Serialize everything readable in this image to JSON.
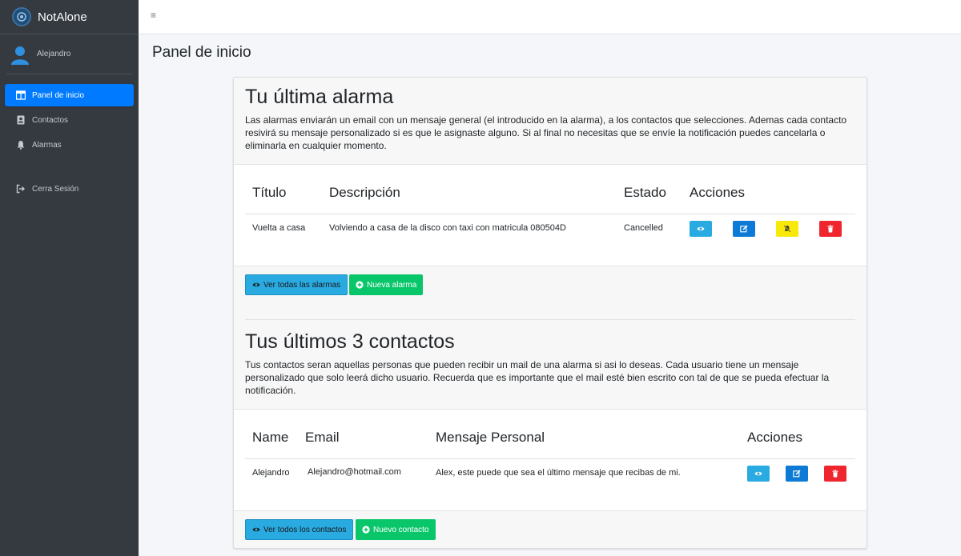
{
  "app": {
    "name": "NotAlone"
  },
  "user": {
    "name": "Alejandro"
  },
  "sidebar": {
    "items": [
      {
        "label": "Panel de inicio",
        "active": true
      },
      {
        "label": "Contactos",
        "active": false
      },
      {
        "label": "Alarmas",
        "active": false
      },
      {
        "label": "Cerra Sesión",
        "active": false
      }
    ]
  },
  "topbar": {
    "menu_glyph": "≡"
  },
  "page": {
    "title": "Panel de inicio"
  },
  "alarms": {
    "title": "Tu última alarma",
    "description": "Las alarmas enviarán un email con un mensaje general (el introducido en la alarma), a los contactos que selecciones. Ademas cada contacto resivirá su mensaje personalizado si es que le asignaste alguno. Si al final no necesitas que se envíe la notificación puedes cancelarla o eliminarla en cualquier momento.",
    "columns": [
      "Título",
      "Descripción",
      "Estado",
      "Acciones"
    ],
    "rows": [
      {
        "titulo": "Vuelta a casa",
        "descripcion": "Volviendo a casa de la disco con taxi con matricula 080504D",
        "estado": "Cancelled"
      }
    ],
    "view_all_label": "Ver todas las alarmas",
    "new_label": "Nueva alarma"
  },
  "contacts": {
    "title": "Tus últimos 3 contactos",
    "description": "Tus contactos seran aquellas personas que pueden recibir un mail de una alarma si asi lo deseas. Cada usuario tiene un mensaje personalizado que solo leerá dicho usuario. Recuerda que es importante que el mail esté bien escrito con tal de que se pueda efectuar la notificación.",
    "columns": [
      "Name",
      "Email",
      "Mensaje Personal",
      "Acciones"
    ],
    "rows": [
      {
        "name": "Alejandro",
        "email": "Alejandro@hotmail.com",
        "mensaje": "Alex, este puede que sea el último mensaje que recibas de mi."
      }
    ],
    "view_all_label": "Ver todos los contactos",
    "new_label": "Nuevo contacto"
  },
  "colors": {
    "sidebar": "#343a40",
    "active": "#007bff",
    "info": "#29aae1",
    "primary": "#0d7ad6",
    "warning": "#f9e90b",
    "danger": "#f0262e",
    "success": "#09c66a"
  }
}
